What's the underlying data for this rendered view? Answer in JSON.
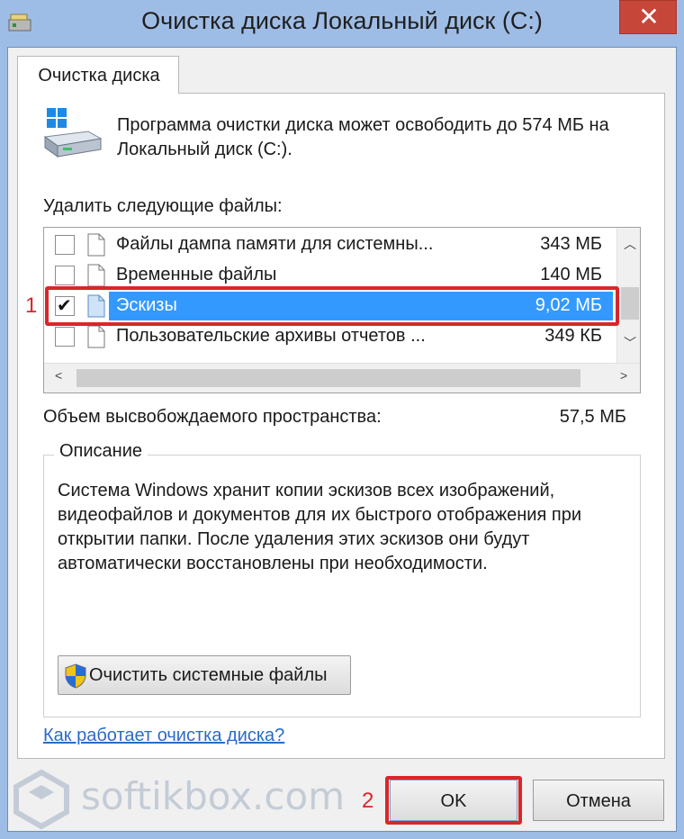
{
  "window": {
    "title": "Очистка диска Локальный диск (C:)",
    "close_symbol": "✕",
    "app_icon": "disk-cleanup-icon"
  },
  "tab": {
    "label": "Очистка диска"
  },
  "intro": {
    "text": "Программа очистки диска может освободить до 574 МБ на Локальный диск (C:).",
    "icon": "drive-cleanup-icon"
  },
  "files_label": "Удалить следующие файлы:",
  "file_list": [
    {
      "name": "Файлы дампа памяти для системны...",
      "size": "343 МБ",
      "checked": false,
      "selected": false
    },
    {
      "name": "Временные файлы",
      "size": "140 МБ",
      "checked": false,
      "selected": false
    },
    {
      "name": "Эскизы",
      "size": "9,02 МБ",
      "checked": true,
      "selected": true
    },
    {
      "name": "Пользовательские архивы отчетов ...",
      "size": "349 КБ",
      "checked": false,
      "selected": false
    }
  ],
  "space": {
    "label": "Объем высвобождаемого пространства:",
    "value": "57,5 МБ"
  },
  "description": {
    "title": "Описание",
    "text": "Система Windows хранит копии эскизов всех изображений, видеофайлов и документов для их быстрого отображения при открытии папки. После удаления этих эскизов они будут автоматически восстановлены при необходимости."
  },
  "cleanup_button": {
    "label": "Очистить системные файлы",
    "icon": "uac-shield-icon"
  },
  "help_link": "Как работает очистка диска?",
  "buttons": {
    "ok": "OK",
    "cancel": "Отмена"
  },
  "annotations": {
    "marker_1": "1",
    "marker_2": "2"
  },
  "watermark": {
    "text": "softikbox.com"
  },
  "colors": {
    "selection": "#3399ff",
    "annotation_red": "#d8262b",
    "close_red": "#c7463a",
    "link_blue": "#2a6cc4",
    "frame_blue": "#9ebde6"
  }
}
